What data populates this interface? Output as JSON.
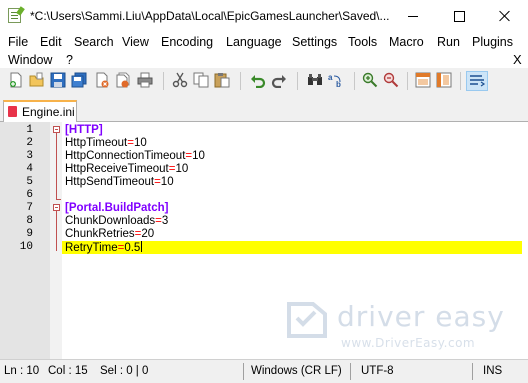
{
  "window": {
    "title": "*C:\\Users\\Sammi.Liu\\AppData\\Local\\EpicGamesLauncher\\Saved\\..."
  },
  "menu": {
    "items": [
      "File",
      "Edit",
      "Search",
      "View",
      "Encoding",
      "Language",
      "Settings",
      "Tools",
      "Macro",
      "Run",
      "Plugins",
      "Window",
      "?"
    ],
    "doc_close": "X"
  },
  "toolbar": {
    "icons": [
      "new-file-icon",
      "open-file-icon",
      "save-icon",
      "save-all-icon",
      "close-icon",
      "close-all-icon",
      "print-icon",
      "cut-icon",
      "copy-icon",
      "paste-icon",
      "undo-icon",
      "redo-icon",
      "find-icon",
      "replace-icon",
      "zoom-in-icon",
      "zoom-out-icon",
      "sync-vertical-icon",
      "sync-horizontal-icon",
      "word-wrap-icon"
    ]
  },
  "tab": {
    "label": "Engine.ini"
  },
  "editor": {
    "lines": [
      {
        "num": "1",
        "kind": "section",
        "text": "[HTTP]"
      },
      {
        "num": "2",
        "kind": "kv",
        "key": "HttpTimeout",
        "eq": "=",
        "value": "10"
      },
      {
        "num": "3",
        "kind": "kv",
        "key": "HttpConnectionTimeout",
        "eq": "=",
        "value": "10"
      },
      {
        "num": "4",
        "kind": "kv",
        "key": "HttpReceiveTimeout",
        "eq": "=",
        "value": "10"
      },
      {
        "num": "5",
        "kind": "kv",
        "key": "HttpSendTimeout",
        "eq": "=",
        "value": "10"
      },
      {
        "num": "6",
        "kind": "blank",
        "text": ""
      },
      {
        "num": "7",
        "kind": "section",
        "text": "[Portal.BuildPatch]"
      },
      {
        "num": "8",
        "kind": "kv",
        "key": "ChunkDownloads",
        "eq": "=",
        "value": "3"
      },
      {
        "num": "9",
        "kind": "kv",
        "key": "ChunkRetries",
        "eq": "=",
        "value": "20"
      },
      {
        "num": "10",
        "kind": "kv",
        "key": "RetryTime",
        "eq": "=",
        "value": "0.5"
      }
    ],
    "current_line": 10
  },
  "watermark": {
    "brand": "driver easy",
    "url": "www.DriverEasy.com"
  },
  "status": {
    "ln": "Ln : 10",
    "col": "Col : 15",
    "sel": "Sel : 0 | 0",
    "eol": "Windows (CR LF)",
    "encoding": "UTF-8",
    "mode": "INS"
  },
  "colors": {
    "section": "#8000ff",
    "operator": "#ff0000",
    "current_line_highlight": "#ffff00",
    "tab_accent": "#f7b24a"
  }
}
